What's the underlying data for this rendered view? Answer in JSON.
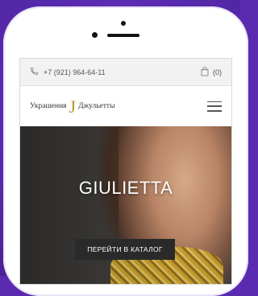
{
  "topbar": {
    "phone": "+7 (921) 964-64-11",
    "cart_count": "(0)"
  },
  "header": {
    "logo_left": "Украшения",
    "logo_mark": "J",
    "logo_right": "Джульетты"
  },
  "hero": {
    "title": "GIULIETTA",
    "cta_label": "ПЕРЕЙТИ В КАТАЛОГ"
  },
  "icons": {
    "phone": "phone-icon",
    "cart": "shopping-bag-icon",
    "menu": "hamburger-menu-icon"
  },
  "colors": {
    "background": "#5a2bb0",
    "logo_accent": "#b8952b",
    "cta_background": "#2a2a2a"
  }
}
